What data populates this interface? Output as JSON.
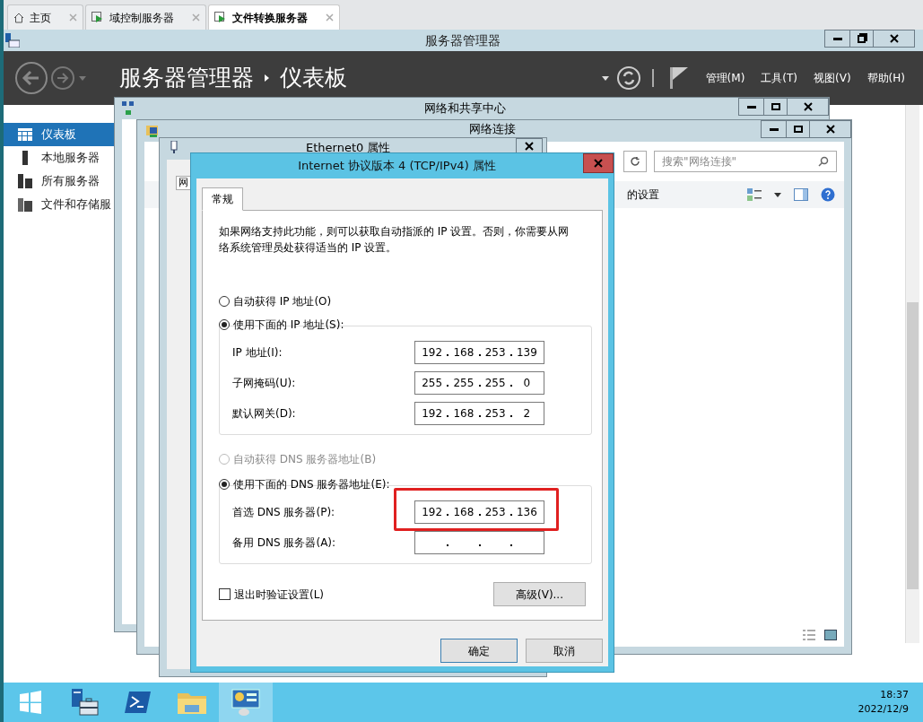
{
  "browser_tabs": [
    {
      "label": "主页",
      "kind": "home",
      "selected": false
    },
    {
      "label": "域控制服务器",
      "kind": "remote",
      "selected": false
    },
    {
      "label": "文件转换服务器",
      "kind": "remote",
      "selected": true
    }
  ],
  "server_manager": {
    "title": "服务器管理器",
    "breadcrumb": [
      "服务器管理器",
      "仪表板"
    ],
    "menu": [
      "管理(M)",
      "工具(T)",
      "视图(V)",
      "帮助(H)"
    ],
    "sidebar": [
      {
        "label": "仪表板",
        "kind": "dashboard",
        "selected": true
      },
      {
        "label": "本地服务器",
        "kind": "local",
        "selected": false
      },
      {
        "label": "所有服务器",
        "kind": "all",
        "selected": false
      },
      {
        "label": "文件和存储服",
        "kind": "storage",
        "selected": false
      }
    ]
  },
  "network_center": {
    "title": "网络和共享中心"
  },
  "network_connections": {
    "title": "网络连接",
    "search": {
      "placeholder": "搜索\"网络连接\""
    },
    "toolbar_text": "的设置"
  },
  "ethernet_properties": {
    "title": "Ethernet0 属性",
    "tab": "网"
  },
  "dialog": {
    "title": "Internet 协议版本 4 (TCP/IPv4) 属性",
    "tabs": [
      {
        "label": "常规",
        "selected": true
      }
    ],
    "description": "如果网络支持此功能，则可以获取自动指派的 IP 设置。否则，你需要从网络系统管理员处获得适当的 IP 设置。",
    "ip_mode": [
      {
        "label": "自动获得 IP 地址(O)",
        "selected": false
      },
      {
        "label": "使用下面的 IP 地址(S):",
        "selected": true
      }
    ],
    "ip_fields": [
      {
        "label": "IP 地址(I):",
        "octets": [
          "192",
          "168",
          "253",
          "139"
        ]
      },
      {
        "label": "子网掩码(U):",
        "octets": [
          "255",
          "255",
          "255",
          "0"
        ]
      },
      {
        "label": "默认网关(D):",
        "octets": [
          "192",
          "168",
          "253",
          "2"
        ]
      }
    ],
    "dns_mode": [
      {
        "label": "自动获得 DNS 服务器地址(B)",
        "selected": false,
        "disabled": true
      },
      {
        "label": "使用下面的 DNS 服务器地址(E):",
        "selected": true,
        "disabled": false
      }
    ],
    "dns_fields": [
      {
        "label": "首选 DNS 服务器(P):",
        "octets": [
          "192",
          "168",
          "253",
          "136"
        ],
        "annotated": true
      },
      {
        "label": "备用 DNS 服务器(A):",
        "annotated": false
      }
    ],
    "validate_on_exit": {
      "label": "退出时验证设置(L)",
      "checked": false
    },
    "advanced_button": "高级(V)...",
    "buttons": [
      {
        "label": "确定",
        "default": true
      },
      {
        "label": "取消",
        "default": false
      }
    ]
  },
  "taskbar": {
    "items": [
      {
        "kind": "start"
      },
      {
        "kind": "server-manager"
      },
      {
        "kind": "powershell"
      },
      {
        "kind": "explorer"
      },
      {
        "kind": "control-panel"
      }
    ],
    "time": "18:37",
    "date": "2022/12/9"
  }
}
